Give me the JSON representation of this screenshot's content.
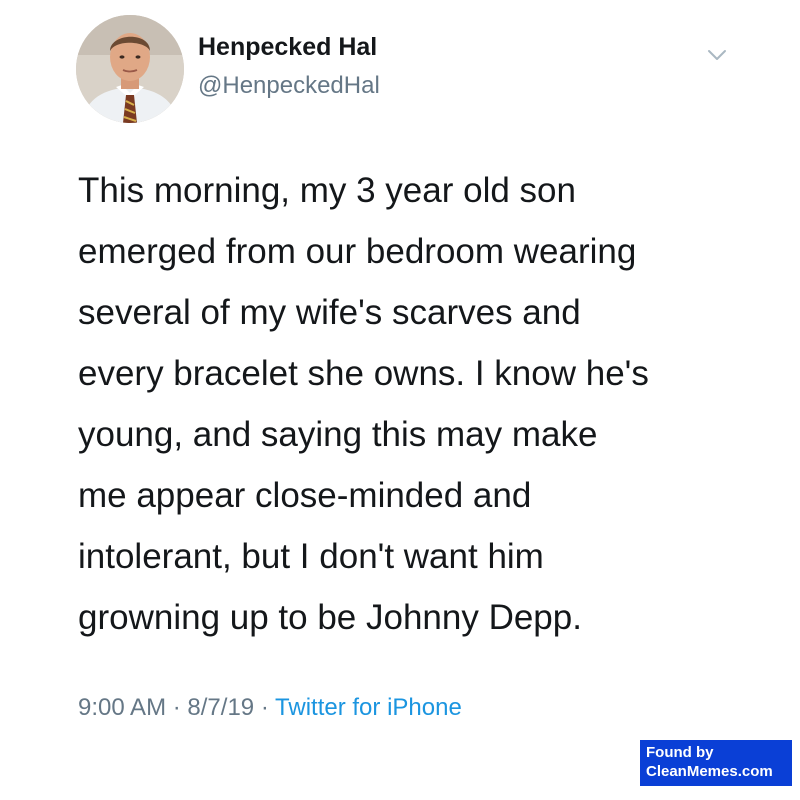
{
  "tweet": {
    "author": {
      "name": "Henpecked Hal",
      "handle": "@HenpeckedHal"
    },
    "body_lines": [
      "This morning, my 3 year old son",
      "emerged from our bedroom wearing",
      "several of my wife's scarves and",
      "every bracelet she owns. I know he's",
      "young, and saying this may make",
      "me appear close-minded and",
      "intolerant, but I don't want him",
      "growning up to be Johnny Depp."
    ],
    "meta": {
      "time": "9:00 AM",
      "separator": "·",
      "date": "8/7/19",
      "source": "Twitter for iPhone"
    }
  },
  "icons": {
    "menu": "chevron-down-icon"
  },
  "colors": {
    "text": "#14171a",
    "secondary": "#657786",
    "link": "#1b95e0",
    "watermark_bg": "#0a3fd6"
  },
  "watermark": {
    "line1": "Found by",
    "line2": "CleanMemes.com"
  }
}
